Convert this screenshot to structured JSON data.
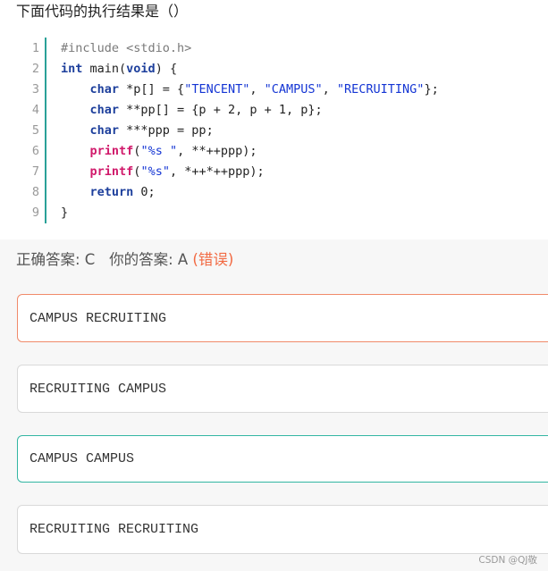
{
  "question": {
    "text": "下面代码的执行结果是（）"
  },
  "code": {
    "line_numbers": [
      "1",
      "2",
      "3",
      "4",
      "5",
      "6",
      "7",
      "8",
      "9"
    ],
    "lines": [
      [
        {
          "t": "pre",
          "v": "#include <stdio.h>"
        }
      ],
      [
        {
          "t": "kw",
          "v": "int"
        },
        {
          "t": "plain",
          "v": " main("
        },
        {
          "t": "kw",
          "v": "void"
        },
        {
          "t": "plain",
          "v": ") {"
        }
      ],
      [
        {
          "t": "plain",
          "v": "    "
        },
        {
          "t": "kw",
          "v": "char"
        },
        {
          "t": "plain",
          "v": " *p[] = {"
        },
        {
          "t": "str",
          "v": "\"TENCENT\""
        },
        {
          "t": "plain",
          "v": ", "
        },
        {
          "t": "str",
          "v": "\"CAMPUS\""
        },
        {
          "t": "plain",
          "v": ", "
        },
        {
          "t": "str",
          "v": "\"RECRUITING\""
        },
        {
          "t": "plain",
          "v": "};"
        }
      ],
      [
        {
          "t": "plain",
          "v": "    "
        },
        {
          "t": "kw",
          "v": "char"
        },
        {
          "t": "plain",
          "v": " **pp[] = {p + 2, p + 1, p};"
        }
      ],
      [
        {
          "t": "plain",
          "v": "    "
        },
        {
          "t": "kw",
          "v": "char"
        },
        {
          "t": "plain",
          "v": " ***ppp = pp;"
        }
      ],
      [
        {
          "t": "plain",
          "v": "    "
        },
        {
          "t": "fn",
          "v": "printf"
        },
        {
          "t": "plain",
          "v": "("
        },
        {
          "t": "str",
          "v": "\"%s \""
        },
        {
          "t": "plain",
          "v": ", **++ppp);"
        }
      ],
      [
        {
          "t": "plain",
          "v": "    "
        },
        {
          "t": "fn",
          "v": "printf"
        },
        {
          "t": "plain",
          "v": "("
        },
        {
          "t": "str",
          "v": "\"%s\""
        },
        {
          "t": "plain",
          "v": ", *++*++ppp);"
        }
      ],
      [
        {
          "t": "plain",
          "v": "    "
        },
        {
          "t": "kw",
          "v": "return"
        },
        {
          "t": "plain",
          "v": " 0;"
        }
      ],
      [
        {
          "t": "plain",
          "v": "}"
        }
      ]
    ]
  },
  "answer": {
    "correct_label": "正确答案: C",
    "yours_label": "你的答案: A",
    "status": "(错误)"
  },
  "options": [
    {
      "text": "CAMPUS RECRUITING",
      "state": "selected-wrong"
    },
    {
      "text": "RECRUITING CAMPUS",
      "state": "normal"
    },
    {
      "text": "CAMPUS CAMPUS",
      "state": "correct"
    },
    {
      "text": "RECRUITING RECRUITING",
      "state": "normal"
    }
  ],
  "watermark": "CSDN @QJ敬",
  "colors": {
    "accent_teal": "#2aa198",
    "wrong_orange": "#f26a43",
    "correct_border": "#33b6a3",
    "wrong_border": "#f08a6a"
  }
}
